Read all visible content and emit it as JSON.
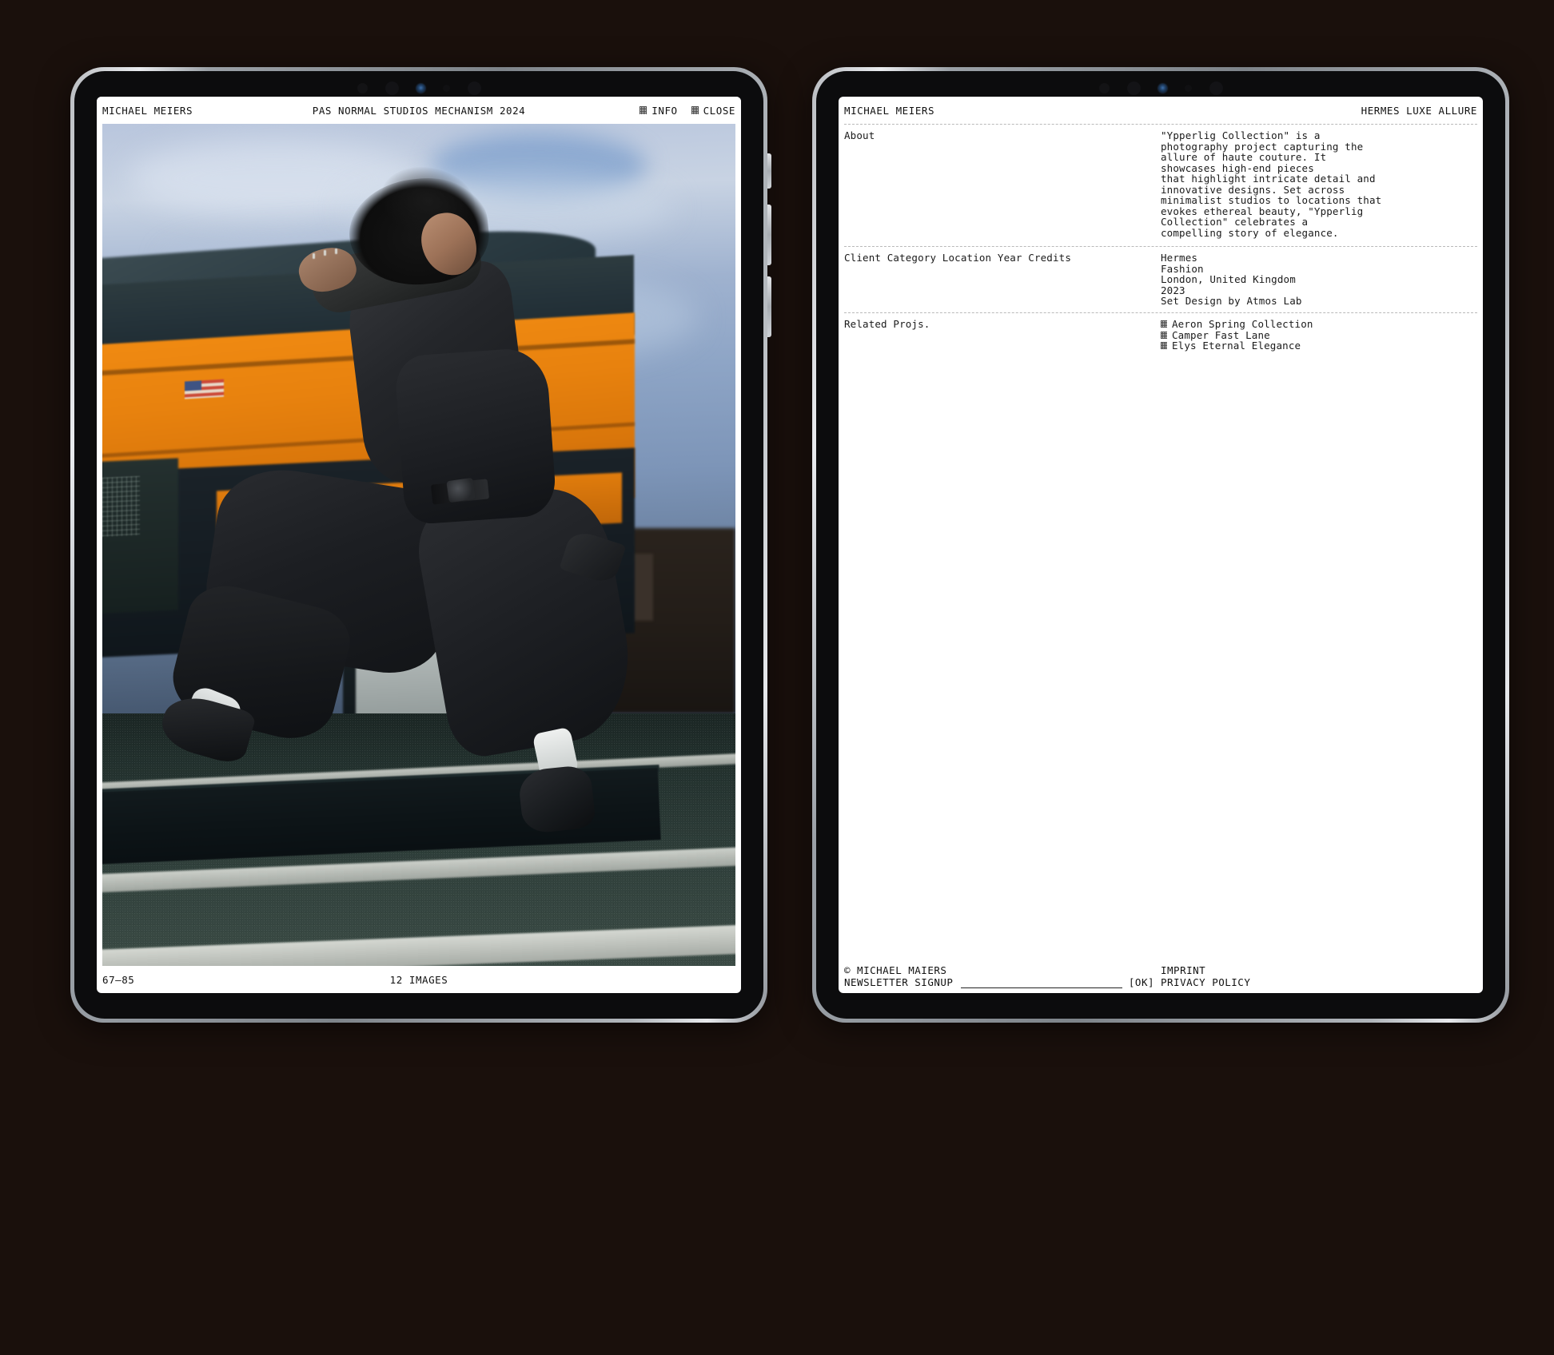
{
  "theme": {
    "page_background": "#1a100c",
    "screen_background": "#ffffff",
    "text_color": "#111111"
  },
  "gallery": {
    "header": {
      "brand": "MICHAEL MEIERS",
      "project_title": "PAS NORMAL STUDIOS MECHANISM 2024",
      "info_label": "INFO",
      "close_label": "CLOSE",
      "info_icon": "grid-dither-icon",
      "close_icon": "grid-dither-icon"
    },
    "photo": {
      "alt": "Person in black tailored outfit leaping in mid-air in front of a blurred orange city bus at dusk"
    },
    "footer": {
      "counter": "67–85",
      "image_count": "12 IMAGES"
    }
  },
  "info": {
    "header": {
      "brand": "MICHAEL MEIERS",
      "project_title": "HERMES LUXE ALLURE"
    },
    "about": {
      "label": "About",
      "text": "\"Ypperlig Collection\" is a\nphotography project capturing the\nallure of haute couture. It\nshowcases high-end pieces\nthat highlight intricate detail and\ninnovative designs. Set across\nminimalist studios to locations that\nevokes ethereal beauty, \"Ypperlig\nCollection\" celebrates a\ncompelling story of elegance."
    },
    "meta": {
      "labels": [
        "Client",
        "Category",
        "Location",
        "Year",
        "Credits"
      ],
      "values": [
        "Hermes",
        "Fashion",
        "London, United Kingdom",
        "2023",
        "Set Design by Atmos Lab"
      ]
    },
    "related": {
      "label": "Related Projs.",
      "items": [
        {
          "icon": "grid-dither-icon",
          "title": "Aeron Spring Collection"
        },
        {
          "icon": "grid-dither-icon",
          "title": "Camper Fast Lane"
        },
        {
          "icon": "grid-dither-icon",
          "title": "Elys Eternal Elegance"
        }
      ]
    },
    "footer": {
      "copyright": "© MICHAEL MAIERS",
      "newsletter_label": "NEWSLETTER SIGNUP",
      "newsletter_value": "",
      "newsletter_placeholder": "",
      "ok_label": "[OK]",
      "imprint_label": "IMPRINT",
      "privacy_label": "PRIVACY POLICY"
    }
  },
  "device": {
    "sensors": [
      "sensor-dot",
      "sensor-dot-large",
      "camera-lens",
      "sensor-dot-faint",
      "sensor-dot-large"
    ],
    "side_buttons": [
      "volume-up-button",
      "volume-down-button",
      "power-button"
    ]
  }
}
